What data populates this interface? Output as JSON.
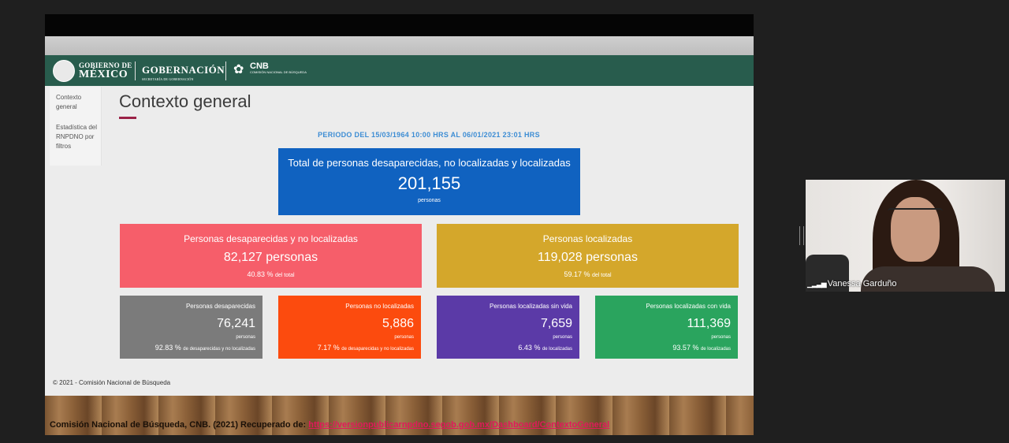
{
  "header": {
    "gob_line1": "GOBIERNO DE",
    "gob_line2": "MÉXICO",
    "gobernacion": "GOBERNACIÓN",
    "gobernacion_sub": "SECRETARÍA DE GOBERNACIÓN",
    "cnb": "CNB",
    "cnb_sub": "COMISIÓN NACIONAL DE BÚSQUEDA",
    "colors": {
      "header_bg": "#285c4d",
      "accent": "#9b2247"
    }
  },
  "sidebar": {
    "items": [
      {
        "label": "Contexto general"
      },
      {
        "label": "Estadística del RNPDNO por filtros"
      }
    ]
  },
  "main": {
    "title": "Contexto general",
    "period": "PERIODO DEL 15/03/1964 10:00 HRS AL 06/01/2021 23:01 HRS",
    "total": {
      "label": "Total de personas desaparecidas, no localizadas y localizadas",
      "value": "201,155",
      "unit": "personas"
    },
    "missing": {
      "label": "Personas desaparecidas y no localizadas",
      "value": "82,127 personas",
      "pct": "40.83 %",
      "pct_suffix": "del total"
    },
    "found": {
      "label": "Personas localizadas",
      "value": "119,028 personas",
      "pct": "59.17 %",
      "pct_suffix": "del total"
    },
    "small_cards": [
      {
        "label": "Personas desaparecidas",
        "value": "76,241",
        "unit": "personas",
        "pct": "92.83 %",
        "pct_suffix": "de desaparecidas y no localizadas"
      },
      {
        "label": "Personas no localizadas",
        "value": "5,886",
        "unit": "personas",
        "pct": "7.17 %",
        "pct_suffix": "de desaparecidas y no localizadas"
      },
      {
        "label": "Personas localizadas sin vida",
        "value": "7,659",
        "unit": "personas",
        "pct": "6.43 %",
        "pct_suffix": "de localizadas"
      },
      {
        "label": "Personas localizadas con vida",
        "value": "111,369",
        "unit": "personas",
        "pct": "93.57 %",
        "pct_suffix": "de localizadas"
      }
    ]
  },
  "footer": {
    "copyright": "© 2021 - Comisión Nacional de Búsqueda"
  },
  "citation": {
    "text": "Comisión Nacional de Búsqueda, CNB. (2021) Recuperado de:",
    "link": "https://versionpublicarnpdno.segob.gob.mx/Dashboard/ContextoGeneral"
  },
  "video": {
    "participant_name": "Vanessa Garduño",
    "signal_icon": "signal-bars-icon"
  }
}
